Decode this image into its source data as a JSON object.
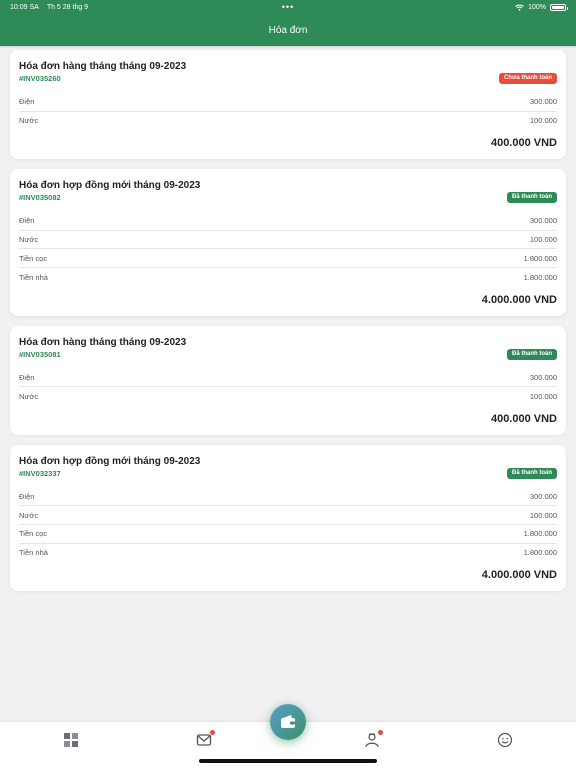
{
  "status_bar": {
    "time": "10:09 SA",
    "date": "Th 5 28 thg 9",
    "dots": "•••",
    "battery": "100%",
    "wifi_icon": "wifi-icon",
    "battery_icon": "battery-icon"
  },
  "header": {
    "title": "Hóa đơn"
  },
  "invoices": [
    {
      "title": "Hóa đơn hàng tháng tháng 09-2023",
      "id": "#INV035260",
      "status": "Chưa thanh toán",
      "status_type": "unpaid",
      "items": [
        {
          "label": "Điện",
          "value": "300.000"
        },
        {
          "label": "Nước",
          "value": "100.000"
        }
      ],
      "total": "400.000 VND"
    },
    {
      "title": "Hóa đơn hợp đồng mới tháng 09-2023",
      "id": "#INV035082",
      "status": "Đã thanh toán",
      "status_type": "paid",
      "items": [
        {
          "label": "Điện",
          "value": "300.000"
        },
        {
          "label": "Nước",
          "value": "100.000"
        },
        {
          "label": "Tiền cọc",
          "value": "1.800.000"
        },
        {
          "label": "Tiền nhà",
          "value": "1.800.000"
        }
      ],
      "total": "4.000.000 VND"
    },
    {
      "title": "Hóa đơn hàng tháng tháng 09-2023",
      "id": "#INV035081",
      "status": "Đã thanh toán",
      "status_type": "paid",
      "items": [
        {
          "label": "Điện",
          "value": "300.000"
        },
        {
          "label": "Nước",
          "value": "100.000"
        }
      ],
      "total": "400.000 VND"
    },
    {
      "title": "Hóa đơn hợp đồng mới tháng 09-2023",
      "id": "#INV032337",
      "status": "Đã thanh toán",
      "status_type": "paid",
      "items": [
        {
          "label": "Điện",
          "value": "300.000"
        },
        {
          "label": "Nước",
          "value": "100.000"
        },
        {
          "label": "Tiền cọc",
          "value": "1.800.000"
        },
        {
          "label": "Tiền nhà",
          "value": "1.800.000"
        }
      ],
      "total": "4.000.000 VND"
    }
  ],
  "tab_bar": {
    "tabs": [
      {
        "icon": "dashboard-icon",
        "badge": false
      },
      {
        "icon": "messages-icon",
        "badge": true
      },
      {
        "icon": "wallet-icon",
        "badge": false,
        "center": true
      },
      {
        "icon": "profile-icon",
        "badge": true
      },
      {
        "icon": "smiley-icon",
        "badge": false
      }
    ]
  },
  "colors": {
    "primary": "#2e8b57",
    "unpaid": "#e74c3c",
    "paid": "#2e8b57",
    "background": "#f1f1f3"
  }
}
